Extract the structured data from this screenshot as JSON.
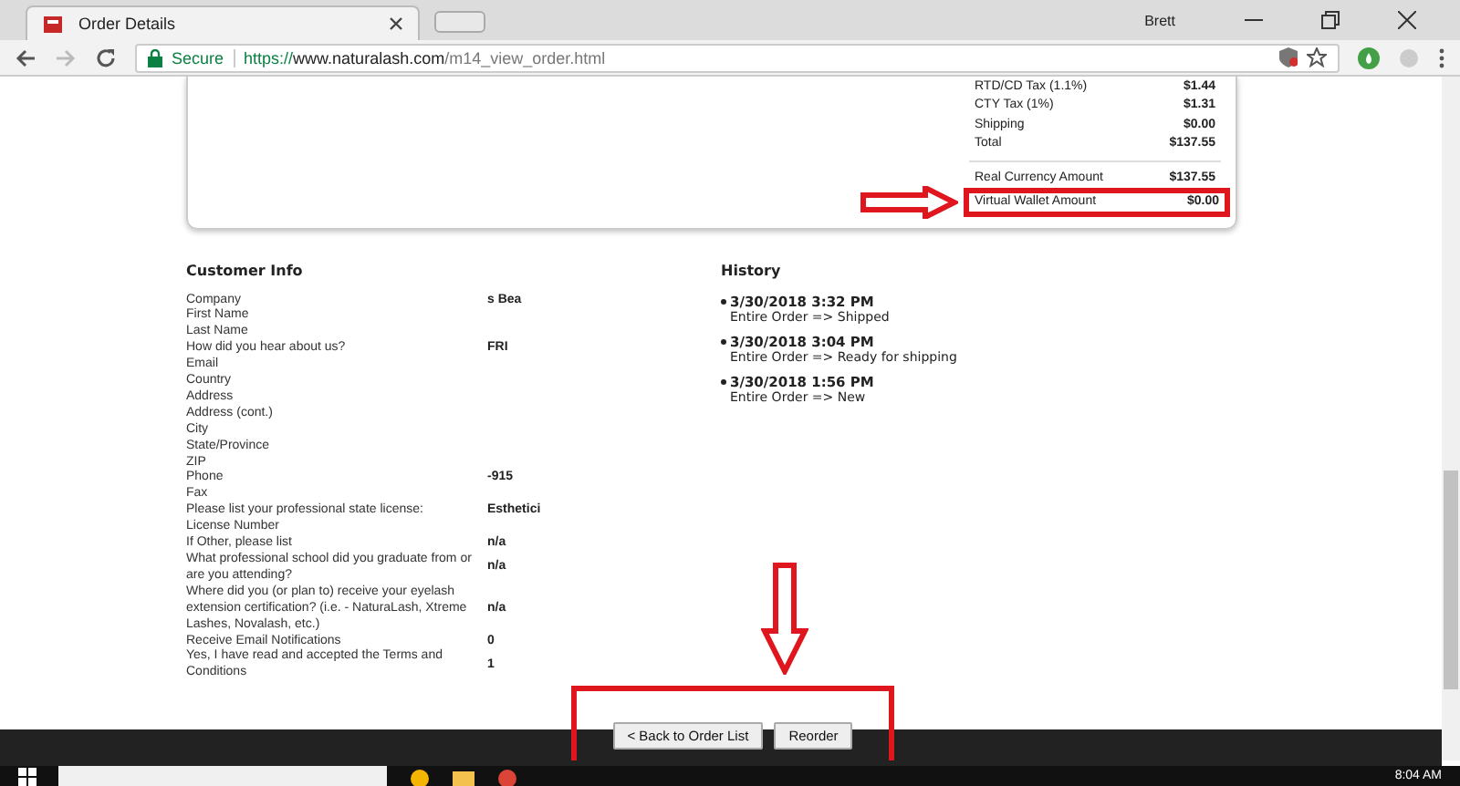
{
  "browser": {
    "tab_title": "Order Details",
    "user": "Brett",
    "secure_label": "Secure",
    "url_scheme": "https://",
    "url_host": "www.naturalash.com",
    "url_path": "/m14_view_order.html"
  },
  "summary": [
    [
      {
        "label": "RTD/CD Tax (1.1%)",
        "value": "$1.44",
        "highlighted": false
      },
      {
        "label": "CTY Tax (1%)",
        "value": "$1.31",
        "highlighted": false
      },
      {
        "label": "Shipping",
        "value": "$0.00",
        "highlighted": false
      },
      {
        "label": "Total",
        "value": "$137.55",
        "highlighted": false
      }
    ],
    [
      {
        "label": "Real Currency Amount",
        "value": "$137.55",
        "highlighted": false
      },
      {
        "label": "Virtual Wallet Amount",
        "value": "$0.00",
        "highlighted": true
      }
    ]
  ],
  "customer_info": {
    "title": "Customer Info",
    "fields": [
      {
        "label": "Company",
        "value": "s Bea"
      },
      {
        "label": "First Name"
      },
      {
        "label": "Last Name"
      },
      {
        "label": "How did you hear about us?",
        "value": "FRI"
      },
      {
        "label": "Email"
      },
      {
        "label": "Country"
      },
      {
        "label": "Address"
      },
      {
        "label": "Address (cont.)"
      },
      {
        "label": "City"
      },
      {
        "label": "State/Province"
      },
      {
        "label": "ZIP"
      },
      {
        "label": "Phone",
        "value": "-915"
      },
      {
        "label": "Fax"
      },
      {
        "label": "Please list your professional state license:",
        "value": "Esthetici"
      },
      {
        "label": "License Number"
      },
      {
        "label": "If Other, please list",
        "value": "n/a"
      },
      {
        "label": "What professional school did you graduate from or are you attending?",
        "value": "n/a"
      },
      {
        "label": "Where did you (or plan to) receive your eyelash extension certification? (i.e. - NaturaLash, Xtreme Lashes, Novalash, etc.)",
        "value": "n/a"
      },
      {
        "label": "Receive Email Notifications",
        "value": "0"
      },
      {
        "label": "Yes, I have read and accepted the Terms and Conditions",
        "value": "1"
      }
    ]
  },
  "history": {
    "title": "History",
    "entries": [
      {
        "time": "3/30/2018 3:32 PM",
        "event": "Entire Order => Shipped"
      },
      {
        "time": "3/30/2018 3:04 PM",
        "event": "Entire Order => Ready for shipping"
      },
      {
        "time": "3/30/2018 1:56 PM",
        "event": "Entire Order => New"
      }
    ]
  },
  "buttons": [
    "< Back to Order List",
    "Reorder"
  ],
  "taskbar": {
    "clock": "8:04 AM"
  }
}
